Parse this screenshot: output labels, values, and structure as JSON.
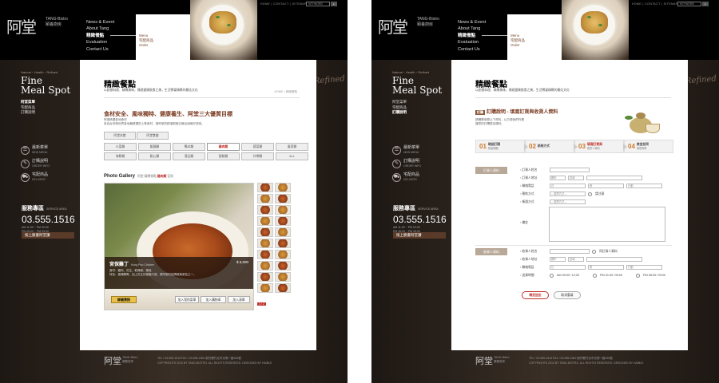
{
  "brand": {
    "logo": "阿堂",
    "sub_en": "TANG-Bistro",
    "sub_zh": "頤養廚房"
  },
  "nav": {
    "items": [
      "News & Event",
      "About Tang",
      "精緻餐點",
      "Evaluation",
      "Contact Us"
    ]
  },
  "subnav": {
    "items": [
      "Menu",
      "宅配商品",
      "Order"
    ]
  },
  "utility": {
    "links": "HOME  |  CONTACT  |  SITEMAP",
    "search_placeholder": "KEYWORD"
  },
  "sidebar": {
    "tagline": "Natural・Health・Refined",
    "title_line1": "Fine",
    "title_line2": "Meal Spot",
    "menu": [
      "阿堂菜單",
      "宅配商品",
      "訂購說明"
    ],
    "links": [
      {
        "label": "最新菜單",
        "sub": "NEW MENU"
      },
      {
        "label": "訂購說明",
        "sub": "ORDER INFO"
      },
      {
        "label": "宅配商品",
        "sub": "DELIVERY"
      }
    ],
    "refined": "Refined",
    "service_label": "服務專區",
    "service_en": "SERVICE AREA",
    "phone": "03.555.1516",
    "hours1": "AM 11:00 ~ PM 02:00",
    "hours2": "PM 05:00 ~ PM 09:00",
    "fb_button": "按上臉書阿堂讚"
  },
  "page1": {
    "title": "精緻餐點",
    "subtitle": "以創意料理、精緻美味，傳遞健康飲食之美，生活饗宴精緻的最佳文化",
    "breadcrumb": "HOME > 精緻餐點",
    "headline": "食材安全、風味獨特、健康養生、阿堂三大優質目標",
    "desc1": "阿堂精選各地食材",
    "desc2": "來自台灣與世界各地最精選的上等食材，與阿堂的精湛廚藝交織出絕美好滋味。",
    "tabs": [
      "阿堂本館",
      "阿堂食樓"
    ],
    "categories": [
      "小菜類",
      "飯麵類",
      "鴨本類",
      "豬肉類",
      "蔬菜類",
      "蛋家類",
      "海鮮類",
      "點心類",
      "湯品類",
      "甜點類",
      "外帶類",
      "ALL"
    ],
    "selected_category": "豬肉類",
    "gallery_title": "Photo Gallery",
    "gallery_crumb_prefix": "阿堂 精緻餐點",
    "gallery_crumb_sel": "豬肉類",
    "gallery_crumb_suffix": "宮保",
    "dish_name": "宮保雞丁",
    "dish_en": "Kung Pao Chicken",
    "dish_price": "$ 5,000",
    "dish_desc1": "食材：雞肉、花生、乾辣椒、蔥段",
    "dish_desc2": "特色：香辣開胃，加上花生的香脆口感，是阿堂的招牌經典菜色之一。",
    "order_button": "詳細資訊",
    "btn_add": "加入我的菜單",
    "btn_fav": "加入購物車",
    "btn_list": "加入清單",
    "thumb_page": "1 / 2"
  },
  "page2": {
    "title": "精緻餐點",
    "subtitle": "以創意料理、精緻美味，傳遞健康飲食之美，生活饗宴精緻的最佳文化",
    "headline_tag": "訂購",
    "headline": "訂購說明 - 填寫訂貨與收貨人資料",
    "desc1": "請確實填寫以下資料，以方便我們作業",
    "desc2": "讓您的訂購更加順利。",
    "steps": [
      {
        "num": "01",
        "label": "確認訂購",
        "sub": "商品明細"
      },
      {
        "num": "02",
        "label": "結帳方式",
        "sub": ""
      },
      {
        "num": "03",
        "label": "填寫訂貨與",
        "sub": "收貨人資料"
      },
      {
        "num": "04",
        "label": "檢查並同",
        "sub": "填寫資料"
      }
    ],
    "orderer_label": "訂貨人資料",
    "receiver_label": "收貨人資料",
    "fields_order": [
      "訂貨人姓名",
      "訂貨人地址",
      "聯絡電話",
      "匯款方式",
      "帳號方式",
      "備註"
    ],
    "fields_recv": [
      "收貨人姓名",
      "收貨人地址",
      "聯絡電話",
      "送貨時間"
    ],
    "county_placeholder": "縣市",
    "district_placeholder": "區域",
    "day_label": "日",
    "night_label": "夜",
    "mobile_label": "行動",
    "select_placeholder": "-- 選擇方式 --",
    "check_label": "請注意",
    "same_as_orderer": "同訂貨人資料",
    "time_options": [
      "AM 09:00~12:00",
      "PM 01:00~05:00",
      "PM 06:00~09:00"
    ],
    "confirm_button": "確定送出",
    "cancel_button": "取消重填"
  },
  "footer": {
    "logo": "阿堂",
    "sub_en": "TANG-Bistro",
    "sub_zh": "頤養廚房",
    "line1": "TEL / 03-555-1516   FAX / 03-555-1562   新竹縣竹北市光明一路160號",
    "line2": "COPYRIGHTS 2010 BY TANG-BISTRO.  ALL RIGHTS RESERVED.   DESIGNED BY HAIBLE"
  }
}
